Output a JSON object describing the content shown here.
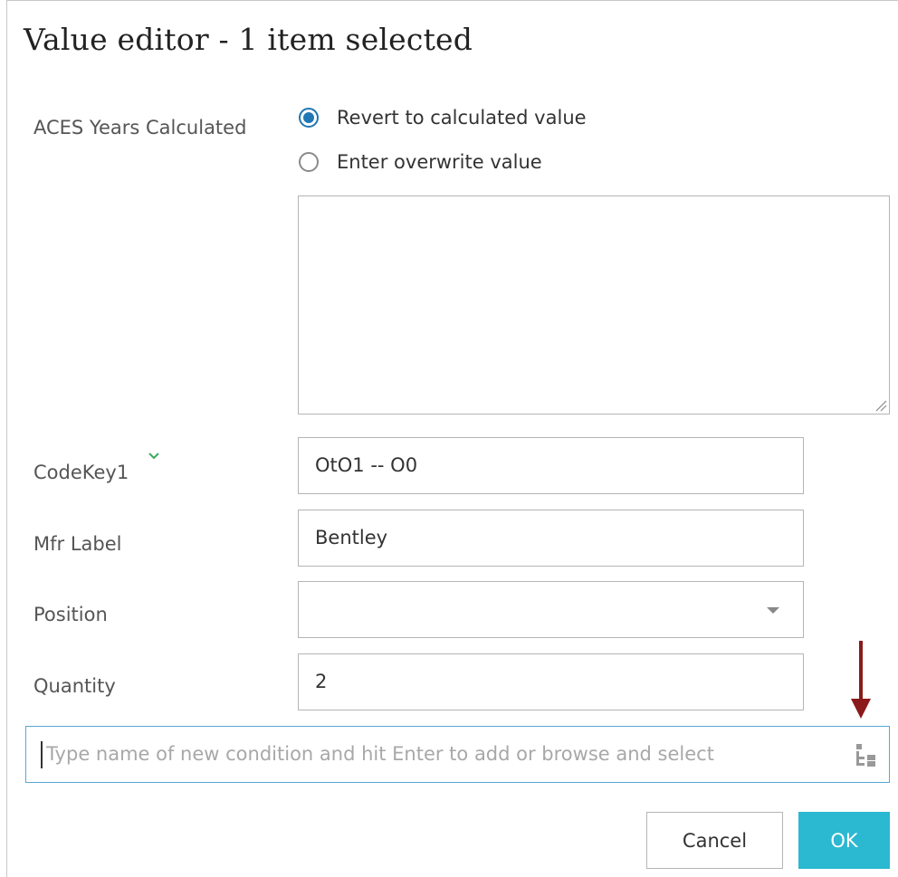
{
  "dialog": {
    "title": "Value editor - 1 item selected"
  },
  "aces_years": {
    "label": "ACES Years Calculated",
    "options": [
      {
        "label": "Revert to calculated value",
        "checked": true
      },
      {
        "label": "Enter overwrite value",
        "checked": false
      }
    ],
    "overwrite_text": ""
  },
  "fields": {
    "codekey": {
      "label": "CodeKey1",
      "value": "OtO1 -- O0"
    },
    "mfr_label": {
      "label": "Mfr Label",
      "value": "Bentley"
    },
    "position": {
      "label": "Position",
      "value": ""
    },
    "quantity": {
      "label": "Quantity",
      "value": "2"
    }
  },
  "condition_input": {
    "placeholder": "Type name of new condition and hit Enter to add or browse and select",
    "value": ""
  },
  "buttons": {
    "cancel": "Cancel",
    "ok": "OK"
  },
  "colors": {
    "accent": "#1f77b4",
    "ok_button": "#2bb8d1",
    "annotation_arrow": "#8b1a1a",
    "chevron": "#3aaa5a"
  },
  "icons": {
    "codekey_indicator": "chevron-down-icon",
    "condition_browse": "tree-browse-icon",
    "annotation": "arrow-down-icon"
  }
}
